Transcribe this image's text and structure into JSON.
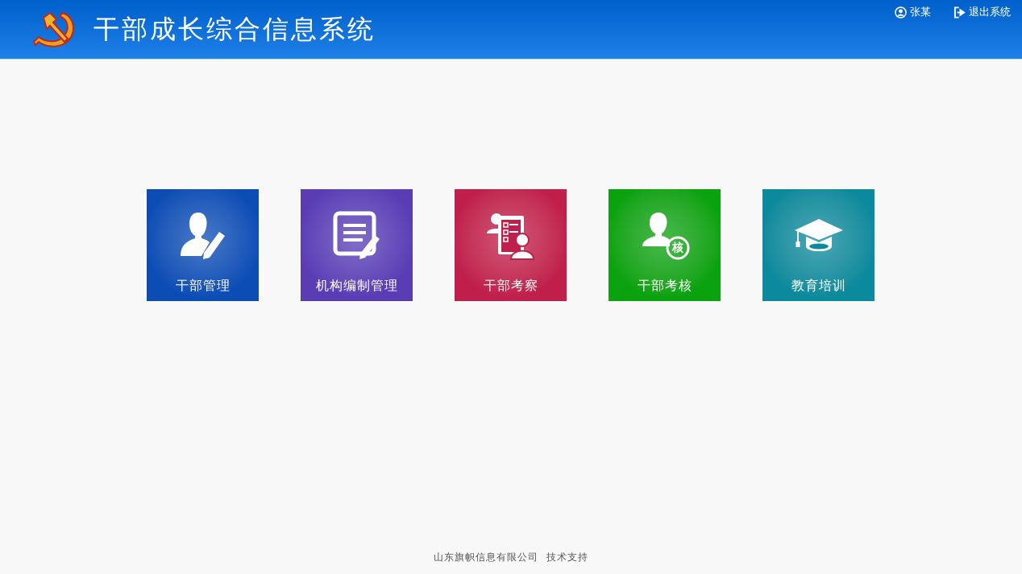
{
  "header": {
    "title": "干部成长综合信息系统",
    "user": "张某",
    "logout": "退出系统"
  },
  "tiles": [
    {
      "label": "干部管理",
      "kind": "person-pen",
      "color": "#0c4db5"
    },
    {
      "label": "机构编制管理",
      "kind": "document-pen",
      "color": "#5a3db5"
    },
    {
      "label": "干部考察",
      "kind": "clipboard-people",
      "color": "#c01f4c"
    },
    {
      "label": "干部考核",
      "kind": "person-badge",
      "color": "#0aa20e",
      "badge": "核"
    },
    {
      "label": "教育培训",
      "kind": "grad-cap",
      "color": "#0a8a9c"
    }
  ],
  "footer": {
    "company": "山东旗帜信息有限公司",
    "support": "技术支持"
  }
}
